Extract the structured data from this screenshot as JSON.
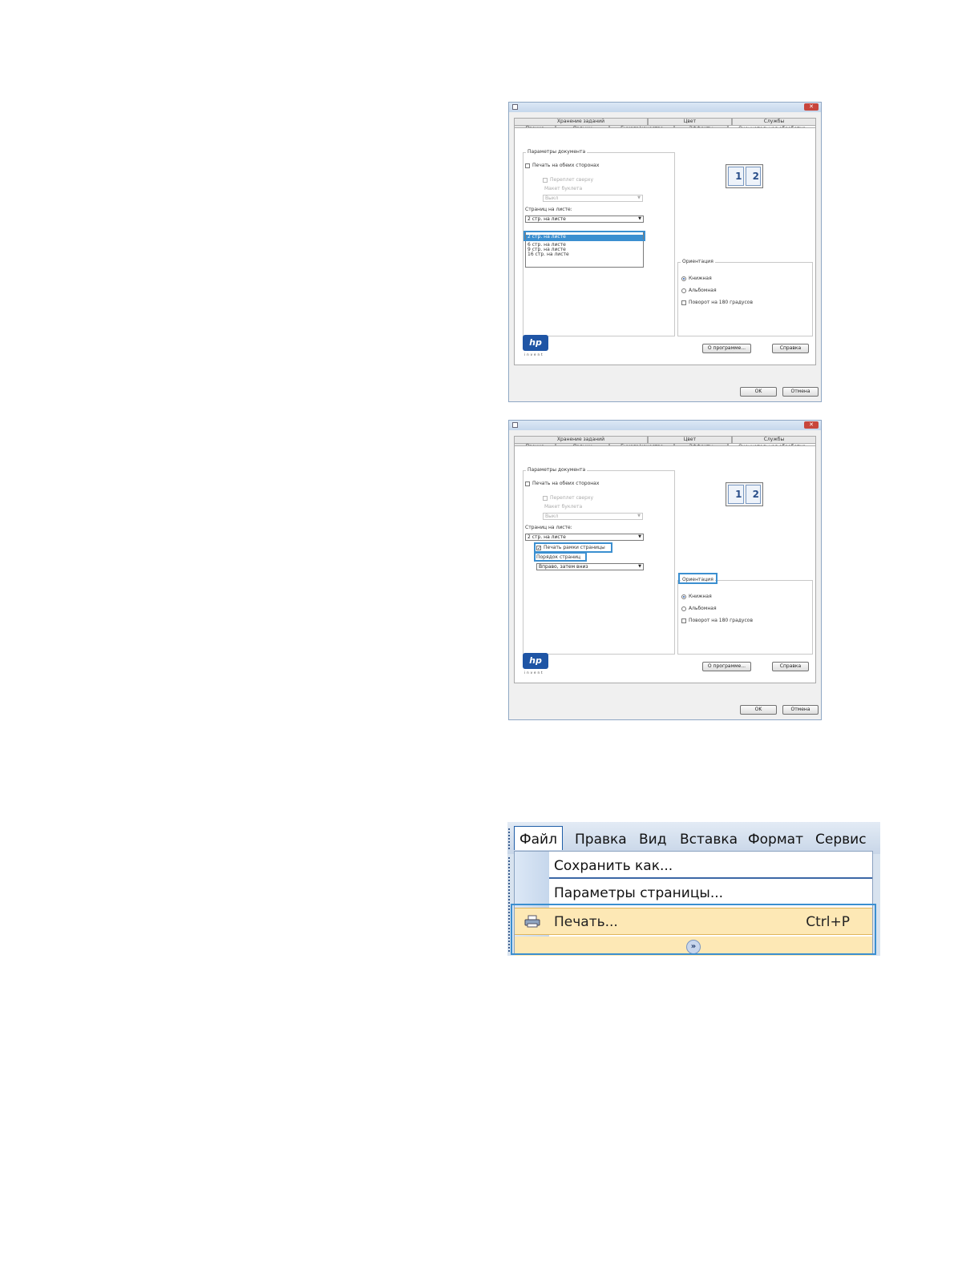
{
  "dialog1": {
    "tabs_top": [
      "Хранение заданий",
      "Цвет",
      "Службы"
    ],
    "tabs_bottom": [
      "Прочие",
      "Ярлыки",
      "Бумага/качество",
      "Эффекты",
      "Окончательная обработка"
    ],
    "group_doc": "Параметры документа",
    "duplex": "Печать на обеих сторонах",
    "flip": "Переплет сверху",
    "booklet": "Макет буклета",
    "booklet_value": "Выкл",
    "pages_per_sheet_label": "Страниц на листе:",
    "pages_per_sheet_value": "2 стр. на листе",
    "dropdown_options": [
      "2 стр. на листе",
      "6 стр. на листе",
      "9 стр. на листе",
      "16 стр. на листе"
    ],
    "orientation": "Ориентация",
    "portrait": "Книжная",
    "landscape": "Альбомная",
    "rotate": "Поворот на 180 градусов",
    "about": "О программе...",
    "help": "Справка",
    "ok": "OK",
    "cancel": "Отмена",
    "preview_pages": [
      "1",
      "2"
    ],
    "logo": "hp",
    "logo_sub": "invent"
  },
  "dialog2": {
    "tabs_top": [
      "Хранение заданий",
      "Цвет",
      "Службы"
    ],
    "tabs_bottom": [
      "Прочие",
      "Ярлыки",
      "Бумага/качество",
      "Эффекты",
      "Окончательная обработка"
    ],
    "group_doc": "Параметры документа",
    "duplex": "Печать на обеих сторонах",
    "flip": "Переплет сверху",
    "booklet": "Макет буклета",
    "booklet_value": "Выкл",
    "pages_per_sheet_label": "Страниц на листе:",
    "pages_per_sheet_value": "2 стр. на листе",
    "print_borders": "Печать рамки страницы",
    "page_order_label": "Порядок страниц",
    "page_order_value": "Вправо, затем вниз",
    "orientation": "Ориентация",
    "portrait": "Книжная",
    "landscape": "Альбомная",
    "rotate": "Поворот на 180 градусов",
    "about": "О программе...",
    "help": "Справка",
    "ok": "OK",
    "cancel": "Отмена",
    "preview_pages": [
      "1",
      "2"
    ],
    "logo": "hp",
    "logo_sub": "invent"
  },
  "menu": {
    "bar": [
      "Файл",
      "Правка",
      "Вид",
      "Вставка",
      "Формат",
      "Сервис"
    ],
    "save_as": "Сохранить как...",
    "page_setup": "Параметры страницы...",
    "print": "Печать...",
    "print_shortcut": "Ctrl+P",
    "expand_icon": "double-chevron-down-icon",
    "printer_icon": "printer-icon"
  },
  "colors": {
    "highlight": "#3b8fd0",
    "menu_hover": "#fde8b5",
    "hp_blue": "#1f55a5"
  }
}
